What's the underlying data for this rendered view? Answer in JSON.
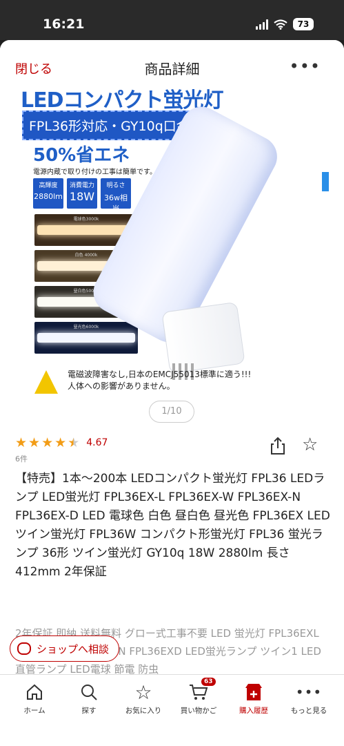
{
  "status_bar": {
    "time": "16:21",
    "battery": "73"
  },
  "header": {
    "close": "閉じる",
    "title": "商品詳細",
    "more": "•••"
  },
  "image": {
    "title": "LEDコンパクト蛍光灯",
    "subtitle": "FPL36形対応・GY10q口金",
    "savings": "50%省エネ",
    "note": "電源内蔵で取り付けの工事は簡単です。",
    "badges": [
      {
        "top": "高輝度",
        "big": "2880lm"
      },
      {
        "top": "消費電力",
        "big": "18W"
      },
      {
        "top": "明るさ",
        "big": "36w相当"
      }
    ],
    "swatches": [
      {
        "label": "電球色3000k",
        "bg": "#3b2a1a",
        "bar": "#fde2b4"
      },
      {
        "label": "白色 4000k",
        "bg": "#4a3a25",
        "bar": "#fff0d6"
      },
      {
        "label": "昼白色5000k",
        "bg": "#2d2a24",
        "bar": "#fbfbf4"
      },
      {
        "label": "昼光色6000k",
        "bg": "#0f1b3a",
        "bar": "#f4f7ff"
      }
    ],
    "warning_line1": "電磁波障害なし,日本のEMCJ55013標準に適う!!!",
    "warning_line2": "人体への影響がありません。"
  },
  "pager": "1/10",
  "rating": {
    "value": "4.67",
    "count": "6件"
  },
  "product_title": "【特売】1本〜200本 LEDコンパクト蛍光灯 FPL36 LEDランプ LED蛍光灯 FPL36EX-L FPL36EX-W FPL36EX-N FPL36EX-D LED 電球色 白色 昼白色 昼光色 FPL36EX LEDツイン蛍光灯 FPL36W コンパクト形蛍光灯 FPL36 蛍光ランプ 36形 ツイン蛍光灯 GY10q 18W 2880lm 長さ412mm 2年保証",
  "product_desc": "2年保証 即納 送料無料 グロー式工事不要 LED 蛍光灯 FPL36EXL FPL36EXW FPL36EXN FPL36EXD LED蛍光ランプ ツイン1 LED直管ランプ LED電球 節電 防虫",
  "shop_button": "ショップへ相談",
  "bottom_nav": {
    "home": "ホーム",
    "search": "探す",
    "favorites": "お気に入り",
    "cart": "買い物かご",
    "cart_count": "63",
    "history": "購入履歴",
    "more": "もっと見る"
  },
  "colors": {
    "accent": "#bf0000",
    "star": "#f29c16",
    "brand_blue": "#1f5fc7"
  }
}
